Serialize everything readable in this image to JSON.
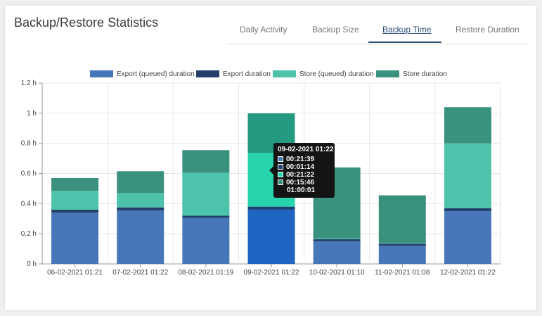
{
  "title": "Backup/Restore Statistics",
  "tabs": [
    {
      "label": "Daily Activity",
      "active": false
    },
    {
      "label": "Backup Size",
      "active": false
    },
    {
      "label": "Backup Time",
      "active": true
    },
    {
      "label": "Restore Duration",
      "active": false
    }
  ],
  "chart_data": {
    "type": "bar",
    "stacked": true,
    "categories": [
      "06-02-2021 01:21",
      "07-02-2021 01:22",
      "08-02-2021 01:19",
      "09-02-2021 01:22",
      "10-02-2021 01:10",
      "11-02-2021 01:08",
      "12-02-2021 01:22"
    ],
    "series": [
      {
        "name": "Export (queued) duration",
        "color": "#4777b8",
        "values": [
          0.34,
          0.355,
          0.305,
          0.36,
          0.15,
          0.12,
          0.35
        ]
      },
      {
        "name": "Export duration",
        "color": "#22406b",
        "values": [
          0.02,
          0.02,
          0.015,
          0.02,
          0.015,
          0.015,
          0.02
        ]
      },
      {
        "name": "Store (queued) duration",
        "color": "#4cc3aa",
        "values": [
          0.125,
          0.095,
          0.285,
          0.356,
          0.005,
          0.005,
          0.43
        ]
      },
      {
        "name": "Store duration",
        "color": "#3a917e",
        "values": [
          0.085,
          0.145,
          0.15,
          0.263,
          0.47,
          0.315,
          0.24
        ]
      }
    ],
    "y_ticks": [
      "0 h",
      "0.2 h",
      "0.4 h",
      "0.6 h",
      "0.8 h",
      "1 h",
      "1.2 h"
    ],
    "ylim": [
      0,
      1.2
    ],
    "grid": true,
    "legend_position": "top",
    "highlight_index": 3,
    "highlight_colors": [
      "#2064c2",
      "#1c3f73",
      "#27d4ad",
      "#249a80"
    ]
  },
  "tooltip": {
    "title": "09-02-2021 01:22",
    "rows": [
      {
        "value": "00:21:39",
        "color": "#4777b8"
      },
      {
        "value": "00:01:14",
        "color": "#22406b"
      },
      {
        "value": "00:21:22",
        "color": "#27d4ad"
      },
      {
        "value": "00:15:46",
        "color": "#3a917e"
      }
    ],
    "total": "01:00:01"
  }
}
